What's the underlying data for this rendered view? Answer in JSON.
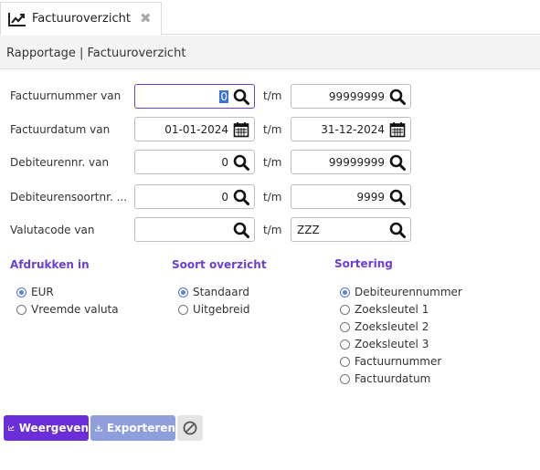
{
  "tab": {
    "title": "Factuuroverzicht",
    "icon": "chart-line-icon",
    "close_icon": "close-icon"
  },
  "breadcrumb": "Rapportage | Factuuroverzicht",
  "rows": [
    {
      "label": "Factuurnummer van",
      "from": "0",
      "to": "99999999"
    },
    {
      "label": "Factuurdatum van",
      "from": "01-01-2024",
      "to": "31-12-2024"
    },
    {
      "label": "Debiteurennr. van",
      "from": "0",
      "to": "99999999"
    },
    {
      "label": "Debiteurensoortnr. ...",
      "from": "0",
      "to": "9999"
    },
    {
      "label": "Valutacode van",
      "from": "",
      "to": "ZZZ"
    }
  ],
  "tm_label": "t/m",
  "afdrukken": {
    "title": "Afdrukken in",
    "options": [
      "EUR",
      "Vreemde valuta"
    ],
    "selected": "EUR"
  },
  "soort": {
    "title": "Soort overzicht",
    "options": [
      "Standaard",
      "Uitgebreid"
    ],
    "selected": "Standaard"
  },
  "sortering": {
    "title": "Sortering",
    "options": [
      "Debiteurennummer",
      "Zoeksleutel 1",
      "Zoeksleutel 2",
      "Zoeksleutel 3",
      "Factuurnummer",
      "Factuurdatum"
    ],
    "selected": "Debiteurennummer"
  },
  "buttons": {
    "show": "Weergeven",
    "export": "Exporteren",
    "cancel_icon": "ban-icon"
  },
  "colors": {
    "accent": "#6b2fd9",
    "export_button": "#8f9fde",
    "heading": "#6b3fd6"
  }
}
